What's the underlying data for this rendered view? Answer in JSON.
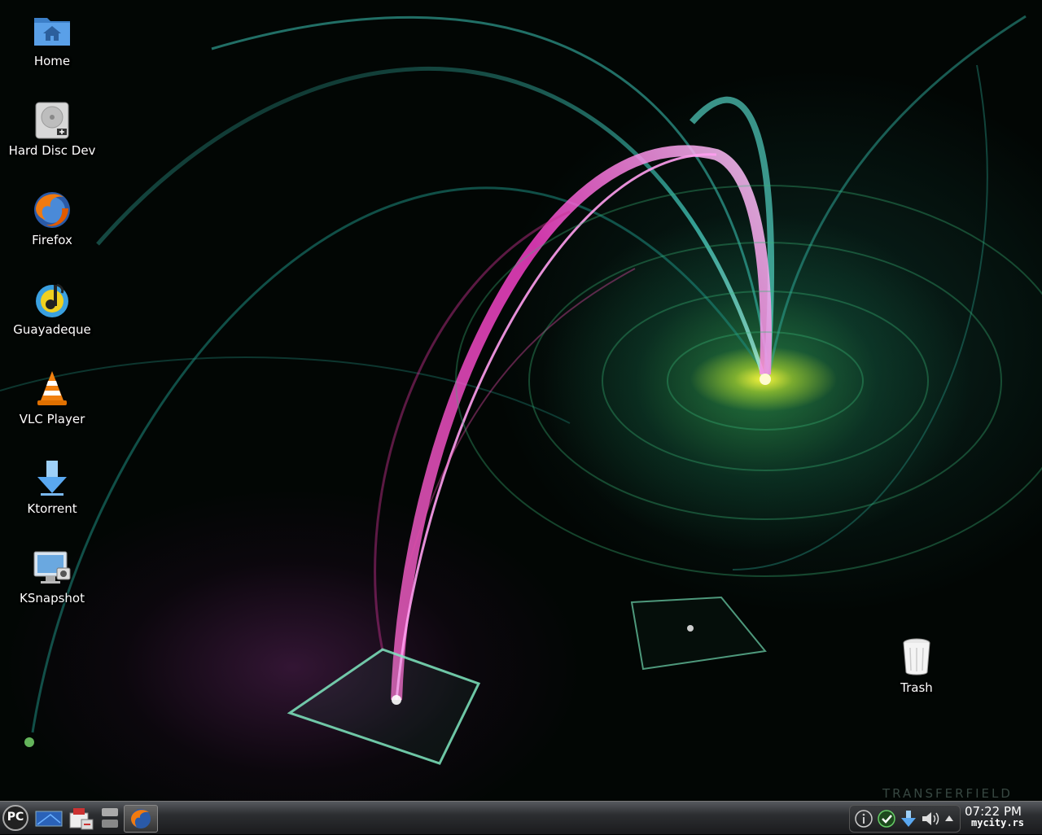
{
  "desktop_icons": [
    {
      "label": "Home",
      "icon": "home-folder-icon"
    },
    {
      "label": "Hard Disc Dev",
      "icon": "hard-disk-icon"
    },
    {
      "label": "Firefox",
      "icon": "firefox-icon"
    },
    {
      "label": "Guayadeque",
      "icon": "guayadeque-icon"
    },
    {
      "label": "VLC Player",
      "icon": "vlc-cone-icon"
    },
    {
      "label": "Ktorrent",
      "icon": "ktorrent-download-icon"
    },
    {
      "label": "KSnapshot",
      "icon": "ksnapshot-monitor-icon"
    },
    {
      "label": "Trash",
      "icon": "trash-bin-icon"
    }
  ],
  "taskbar": {
    "start_label": "PC",
    "clock": "07:22 PM",
    "brand": "mycity.rs",
    "launchers": [
      "desktop-switcher-icon",
      "package-manager-icon",
      "window-list-icon",
      "firefox-task-icon"
    ],
    "tray": [
      "info-icon",
      "update-check-icon",
      "download-arrow-icon",
      "volume-icon",
      "tray-expand-arrow-icon"
    ]
  },
  "wallpaper_watermark": "TRANSFERFIELD",
  "colors": {
    "accent_pink": "#ff4fd8",
    "accent_teal": "#3fe0c8",
    "accent_green": "#6fe070"
  }
}
